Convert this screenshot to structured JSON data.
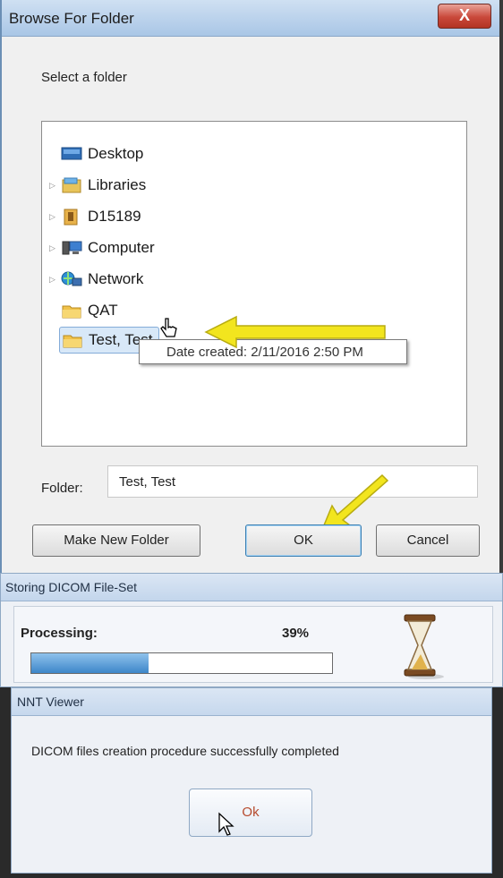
{
  "browse_dialog": {
    "title": "Browse For Folder",
    "close_label": "X",
    "prompt": "Select a folder",
    "tree": [
      {
        "label": "Desktop",
        "icon": "desktop-icon",
        "expandable": false
      },
      {
        "label": "Libraries",
        "icon": "libraries-icon",
        "expandable": true
      },
      {
        "label": "D15189",
        "icon": "user-folder-icon",
        "expandable": true
      },
      {
        "label": "Computer",
        "icon": "computer-icon",
        "expandable": true
      },
      {
        "label": "Network",
        "icon": "network-icon",
        "expandable": true
      },
      {
        "label": "QAT",
        "icon": "folder-icon",
        "expandable": false
      },
      {
        "label": "Test, Test",
        "icon": "folder-icon",
        "expandable": false,
        "selected": true
      }
    ],
    "tooltip": "Date created: 2/11/2016 2:50 PM",
    "folder_label": "Folder:",
    "folder_value": "Test, Test",
    "buttons": {
      "new_folder": "Make New Folder",
      "ok": "OK",
      "cancel": "Cancel"
    }
  },
  "storing_dialog": {
    "title": "Storing DICOM File-Set",
    "processing_label": "Processing:",
    "percent_text": "39%",
    "progress": 0.39
  },
  "nnt_dialog": {
    "title": "NNT Viewer",
    "message": "DICOM files creation procedure successfully completed",
    "ok_label": "Ok"
  },
  "colors": {
    "annotation_arrow": "#f2e51e",
    "progress_fill": "#3d86c9",
    "selection": "#d8e8f8"
  }
}
